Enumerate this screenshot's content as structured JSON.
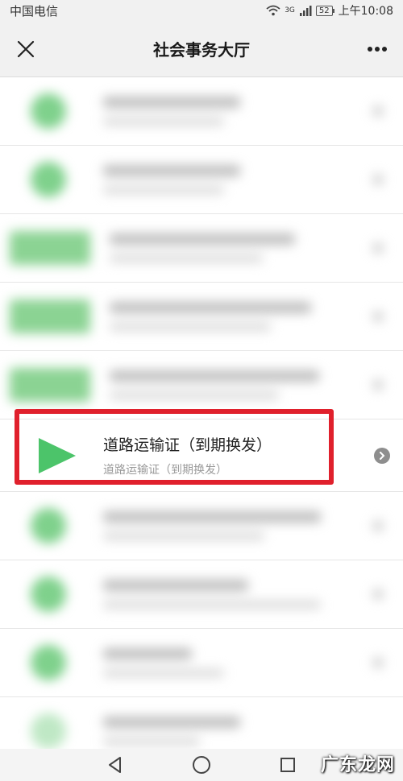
{
  "status_bar": {
    "carrier": "中国电信",
    "network": "3G",
    "battery": "52",
    "time": "上午10:08"
  },
  "header": {
    "title": "社会事务大厅",
    "close_icon": "close-icon",
    "more_icon": "more-icon"
  },
  "featured_item": {
    "title": "道路运输证（到期换发）",
    "subtitle": "道路运输证（到期换发）",
    "icon": "play-icon",
    "accent": "#4cc46a",
    "highlight_color": "#e0202c"
  },
  "watermark": "广东龙网"
}
